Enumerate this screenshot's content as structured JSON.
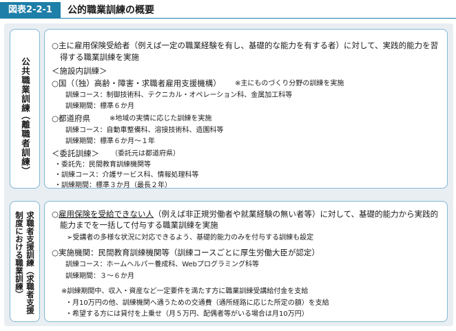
{
  "header": {
    "badge": "図表2-2-1",
    "title": "公的職業訓練の概要"
  },
  "public_training": {
    "label_col1": "公共職業訓練",
    "label_col2": "（離職者訓練）",
    "intro1": "○主に雇用保険受給者（例えば一定の職業経験を有し、基礎的な能力を有する者）に対して、実践的能力を習",
    "intro2": "得する職業訓練を実施",
    "in_facility": "＜施設内訓練＞",
    "national": "○国（（独）高齢・障害・求職者雇用支援機構）",
    "national_note": "※主にものづくり分野の訓練を実施",
    "national_course": "訓練コース：制御技術科、テクニカル・オペレーション科、金属加工科等",
    "national_period": "訓練期間：標準６か月",
    "pref": "○都道府県",
    "pref_note": "※地域の実情に応じた訓練を実施",
    "pref_course": "訓練コース：自動車整備科、溶接技術科、造園科等",
    "pref_period": "訓練期間：標準６か月～１年",
    "consign": "＜委託訓練＞",
    "consign_note": "（委託元は都道府県）",
    "consign_to": "・委託先：民間教育訓練機関等",
    "consign_course": "・訓練コース：介護サービス科、情報処理科等",
    "consign_period": "・訓練期間：標準３か月（最長２年）"
  },
  "seeker_support": {
    "label_col1": "求職者支援訓練（求職者支援",
    "label_col2": "制度における職業訓練）",
    "intro1_pre": "○",
    "intro1_ul": "雇用保険を受給できない人",
    "intro1_post": "（例えば非正規労働者や就業経験の無い者等）に対して、基礎的能力から実践的",
    "intro2": "能力までを一括して付与する職業訓練を実施",
    "sub_note": "➢受講者の多様な状況に対応できるよう、基礎的能力のみを付与する訓練も設定",
    "implementer": "○実施機関：民間教育訓練機関等（訓練コースごとに厚生労働大臣が認定）",
    "course": "訓練コース：ホームヘルパー養成科、Webプログラミング科等",
    "period": "訓練期間：３～６か月",
    "benefit": "※訓練期間中、収入・資産など一定要件を満たす方に職業訓練受講給付金を支給",
    "benefit1": "・月10万円の他、訓練機関へ通うための交通費（通所経路に応じた所定の額）を支給",
    "benefit2": "・希望する方には貸付を上乗せ（月５万円、配偶者等がいる場合は月10万円）"
  }
}
